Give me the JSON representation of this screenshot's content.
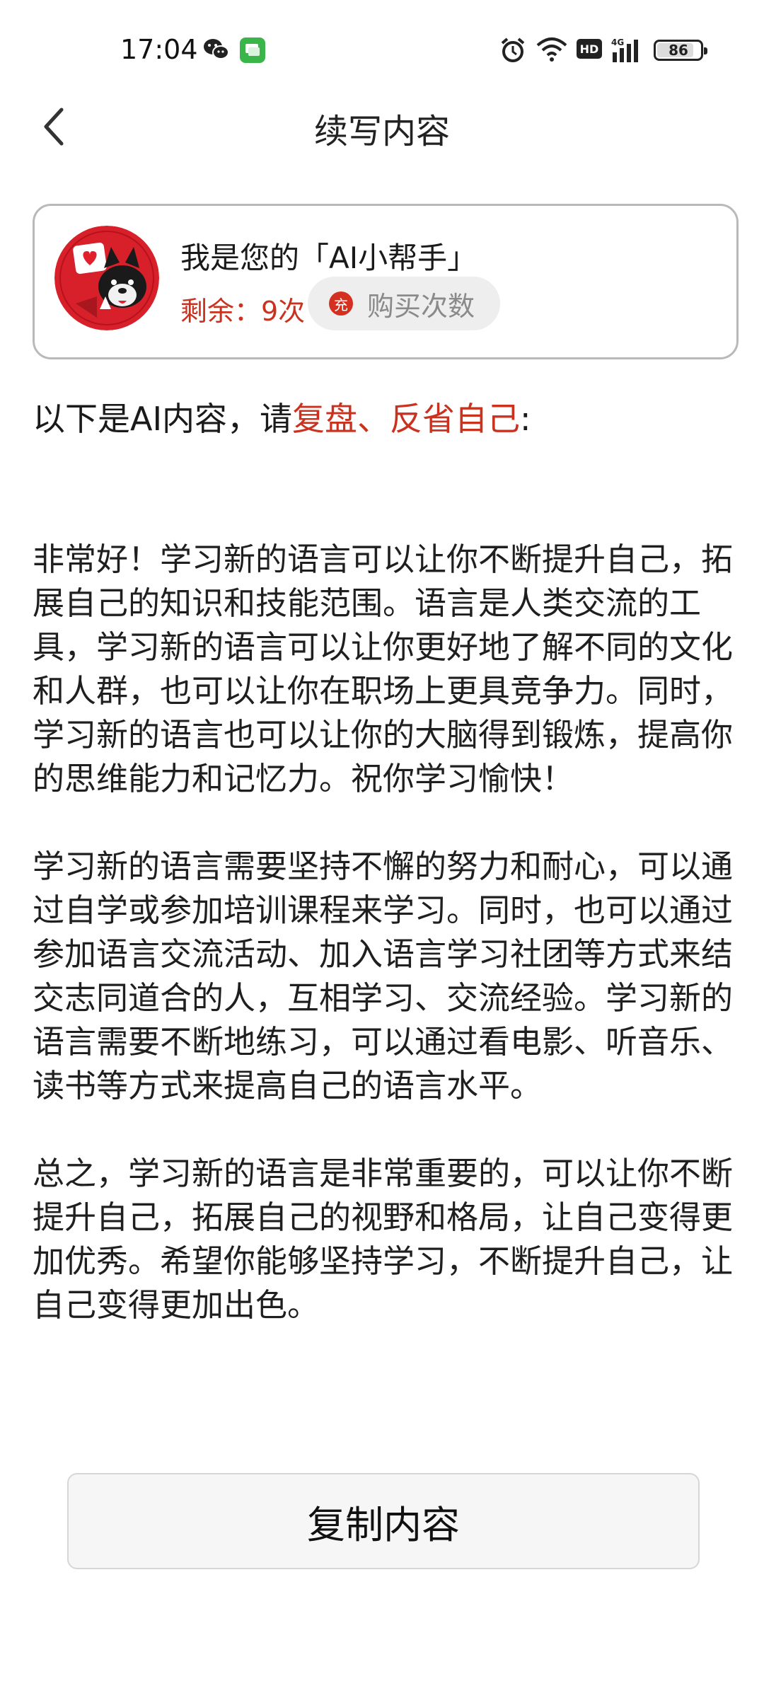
{
  "status_bar": {
    "time": "17:04",
    "network": "4G",
    "hd_label": "HD",
    "battery_level": "86"
  },
  "header": {
    "title": "续写内容"
  },
  "helper_card": {
    "title": "我是您的「AI小帮手」",
    "remaining": "剩余：9次",
    "buy_icon_glyph": "充",
    "buy_label": "购买次数"
  },
  "intro": {
    "prefix": "以下是AI内容，请",
    "highlight": "复盘、反省自己",
    "suffix": ":"
  },
  "content": {
    "paragraphs": [
      "非常好！学习新的语言可以让你不断提升自己，拓展自己的知识和技能范围。语言是人类交流的工具，学习新的语言可以让你更好地了解不同的文化和人群，也可以让你在职场上更具竞争力。同时，学习新的语言也可以让你的大脑得到锻炼，提高你的思维能力和记忆力。祝你学习愉快！",
      "学习新的语言需要坚持不懈的努力和耐心，可以通过自学或参加培训课程来学习。同时，也可以通过参加语言交流活动、加入语言学习社团等方式来结交志同道合的人，互相学习、交流经验。学习新的语言需要不断地练习，可以通过看电影、听音乐、读书等方式来提高自己的语言水平。",
      "总之，学习新的语言是非常重要的，可以让你不断提升自己，拓展自己的视野和格局，让自己变得更加优秀。希望你能够坚持学习，不断提升自己，让自己变得更加出色。"
    ]
  },
  "copy_button": {
    "label": "复制内容"
  },
  "colors": {
    "accent": "#c8321f",
    "card_border": "#b9b9b9",
    "button_bg": "#f6f6f6"
  }
}
